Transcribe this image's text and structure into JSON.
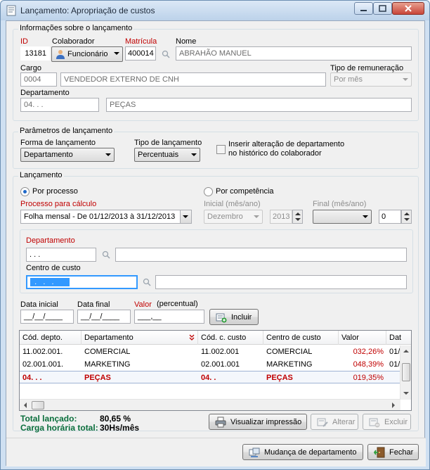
{
  "window": {
    "title": "Lançamento: Apropriação de custos"
  },
  "info": {
    "legend": "Informações sobre o lançamento",
    "id_label": "ID",
    "id_value": "13181",
    "colaborador_label": "Colaborador",
    "colaborador_value": "Funcionário",
    "matricula_label": "Matrícula",
    "matricula_value": "400014",
    "nome_label": "Nome",
    "nome_value": "ABRAHÃO MANUEL",
    "cargo_label": "Cargo",
    "cargo_code": "0004",
    "cargo_name": "VENDEDOR EXTERNO DE CNH",
    "tipo_rem_label": "Tipo de remuneração",
    "tipo_rem_value": "Por mês",
    "departamento_label": "Departamento",
    "departamento_code": "04.     .     .",
    "departamento_name": "PEÇAS"
  },
  "params": {
    "legend": "Parâmetros de lançamento",
    "forma_label": "Forma de lançamento",
    "forma_value": "Departamento",
    "tipo_label": "Tipo de lançamento",
    "tipo_value": "Percentuais",
    "inserir_line1": "Inserir alteração de departamento",
    "inserir_line2": "no histórico do colaborador"
  },
  "lanc": {
    "legend": "Lançamento",
    "por_processo": "Por processo",
    "por_competencia": "Por competência",
    "processo_label": "Processo para cálculo",
    "processo_value": "Folha mensal - De 01/12/2013 à 31/12/2013",
    "inicial_label": "Inicial (mês/ano)",
    "inicial_mes": "Dezembro",
    "inicial_ano": "2013",
    "final_label": "Final (mês/ano)",
    "final_mes": "",
    "final_ano": "0",
    "dept_label": "Departamento",
    "dept_code": ".     .     .",
    "cc_label": "Centro de custo",
    "cc_code": "  .   .   .   ",
    "data_inicial_label": "Data inicial",
    "data_inicial_value": "__/__/____",
    "data_final_label": "Data final",
    "data_final_value": "__/__/____",
    "valor_label": "Valor",
    "percentual_label": "(percentual)",
    "valor_value": "___,__",
    "incluir_label": "Incluir"
  },
  "grid": {
    "columns": [
      "Cód. depto.",
      "Departamento",
      "Cód. c. custo",
      "Centro de custo",
      "Valor",
      "Dat"
    ],
    "rows": [
      {
        "cod_depto": "11.002.001.",
        "departamento": "COMERCIAL",
        "cod_cc": "11.002.001",
        "centro_custo": "COMERCIAL",
        "valor": "032,26%",
        "data": "01/"
      },
      {
        "cod_depto": "02.001.001.",
        "departamento": "MARKETING",
        "cod_cc": "02.001.001",
        "centro_custo": "MARKETING",
        "valor": "048,39%",
        "data": "01/"
      },
      {
        "cod_depto": "04.     .     .",
        "departamento": "PEÇAS",
        "cod_cc": "04.     .",
        "centro_custo": "PEÇAS",
        "valor": "019,35%",
        "data": ""
      }
    ]
  },
  "totals": {
    "lancado_label": "Total lançado:",
    "lancado_value": "80,65 %",
    "carga_label": "Carga horária total:",
    "carga_value": "30Hs/mês"
  },
  "buttons": {
    "visualizar": "Visualizar impressão",
    "alterar": "Alterar",
    "excluir": "Excluir",
    "mudanca": "Mudança de departamento",
    "fechar": "Fechar"
  },
  "colors": {
    "accent_red": "#c00000",
    "total_green": "#0a6e3c",
    "selection_blue": "#3399ff"
  }
}
